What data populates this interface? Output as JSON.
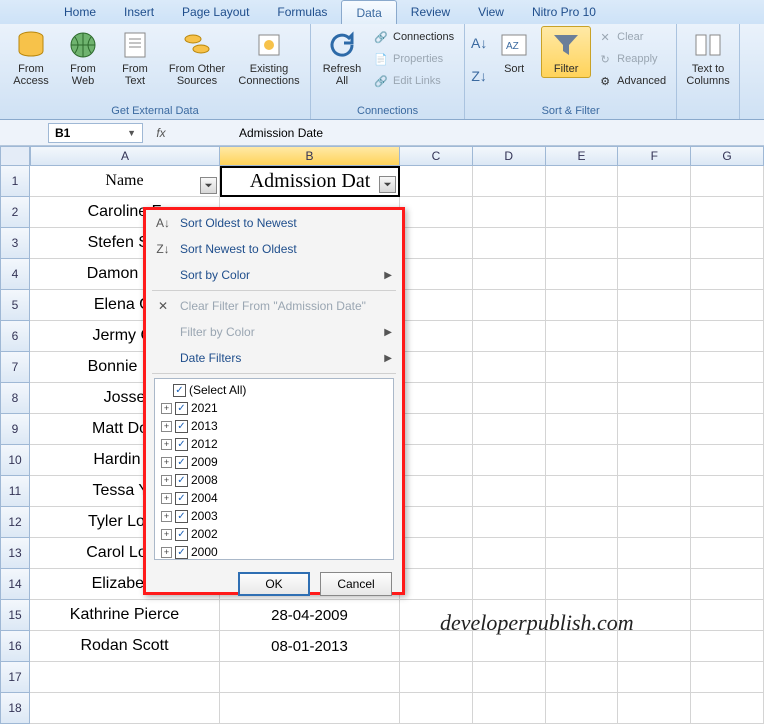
{
  "tabs": [
    "Home",
    "Insert",
    "Page Layout",
    "Formulas",
    "Data",
    "Review",
    "View",
    "Nitro Pro 10"
  ],
  "active_tab": "Data",
  "ribbon": {
    "get_external": {
      "access": "From\nAccess",
      "web": "From\nWeb",
      "text": "From\nText",
      "other": "From Other\nSources",
      "existing": "Existing\nConnections",
      "label": "Get External Data"
    },
    "connections": {
      "refresh": "Refresh\nAll",
      "conn": "Connections",
      "prop": "Properties",
      "edit": "Edit Links",
      "label": "Connections"
    },
    "sortfilter": {
      "sort": "Sort",
      "filter": "Filter",
      "clear": "Clear",
      "reapply": "Reapply",
      "advanced": "Advanced",
      "label": "Sort & Filter"
    },
    "datatools": {
      "textcol": "Text to\nColumns"
    }
  },
  "namebox": "B1",
  "formula": "Admission Date",
  "columns": [
    "A",
    "B",
    "C",
    "D",
    "E",
    "F",
    "G"
  ],
  "headers": {
    "A": "Name",
    "B": "Admission Dat"
  },
  "rows": [
    {
      "n": "1",
      "a": "Name",
      "b": "Admission Dat",
      "hdr": true
    },
    {
      "n": "2",
      "a": "Caroline F",
      "b": ""
    },
    {
      "n": "3",
      "a": "Stefen Sal",
      "b": ""
    },
    {
      "n": "4",
      "a": "Damon Sa",
      "b": ""
    },
    {
      "n": "5",
      "a": "Elena Gi",
      "b": ""
    },
    {
      "n": "6",
      "a": "Jermy Gi",
      "b": ""
    },
    {
      "n": "7",
      "a": "Bonnie Be",
      "b": ""
    },
    {
      "n": "8",
      "a": "Josse",
      "b": ""
    },
    {
      "n": "9",
      "a": "Matt Don",
      "b": ""
    },
    {
      "n": "10",
      "a": "Hardin S",
      "b": ""
    },
    {
      "n": "11",
      "a": "Tessa Yo",
      "b": ""
    },
    {
      "n": "12",
      "a": "Tyler Lock",
      "b": ""
    },
    {
      "n": "13",
      "a": "Carol Lock",
      "b": ""
    },
    {
      "n": "14",
      "a": "Elizabeth",
      "b": ""
    },
    {
      "n": "15",
      "a": "Kathrine Pierce",
      "b": "28-04-2009"
    },
    {
      "n": "16",
      "a": "Rodan Scott",
      "b": "08-01-2013"
    },
    {
      "n": "17",
      "a": "",
      "b": ""
    },
    {
      "n": "18",
      "a": "",
      "b": ""
    }
  ],
  "filter_menu": {
    "sort_asc": "Sort Oldest to Newest",
    "sort_desc": "Sort Newest to Oldest",
    "sort_color": "Sort by Color",
    "clear": "Clear Filter From \"Admission Date\"",
    "filter_color": "Filter by Color",
    "date_filters": "Date Filters",
    "select_all": "(Select All)",
    "years": [
      "2021",
      "2013",
      "2012",
      "2009",
      "2008",
      "2004",
      "2003",
      "2002",
      "2000"
    ],
    "ok": "OK",
    "cancel": "Cancel"
  },
  "watermark": "developerpublish.com"
}
